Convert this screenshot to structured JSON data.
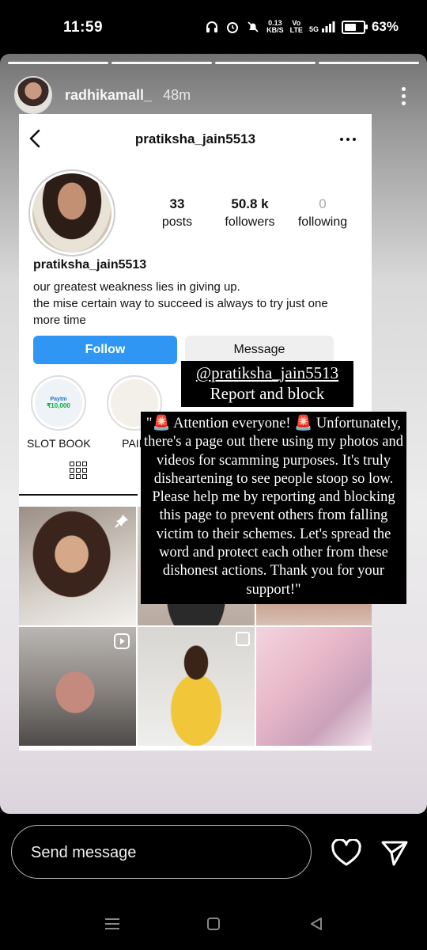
{
  "status_bar": {
    "time": "11:59",
    "net_speed_value": "0.13",
    "net_speed_unit": "KB/S",
    "volte_top": "Vo",
    "volte_bottom": "LTE",
    "network": "5G",
    "battery_percent": "63%",
    "battery_level": 0.63
  },
  "story": {
    "progress_segments": 4,
    "username": "radhikamall_",
    "time_ago": "48m"
  },
  "profile": {
    "header_username": "pratiksha_jain5513",
    "stats": [
      {
        "value": "33",
        "label": "posts"
      },
      {
        "value": "50.8 k",
        "label": "followers"
      },
      {
        "value": "0",
        "label": "following"
      }
    ],
    "display_name": "pratiksha_jain5513",
    "bio_line1": "our greatest weakness lies in giving up.",
    "bio_line2": "the mise certain way to succeed is always to try just one more time",
    "follow_label": "Follow",
    "message_label": "Message",
    "highlights": [
      {
        "label": "SLOT BOOK",
        "brand": "Paytm",
        "amount": "₹10,000"
      },
      {
        "label": "PAID",
        "brand": "",
        "amount": ""
      }
    ]
  },
  "overlay": {
    "tag_handle": "@pratiksha_jain5513",
    "tag_action": "Report and block",
    "message": "\"🚨 Attention everyone! 🚨 Unfortunately, there's a page out there using my photos and videos for scamming purposes. It's truly disheartening to see people stoop so low. Please help me by reporting and blocking this page to prevent others from falling victim to their schemes. Let's spread the word and protect each other from these dishonest actions. Thank you for your support!\""
  },
  "reply_bar": {
    "placeholder": "Send message"
  },
  "icons": {
    "back": "chevron-left-icon",
    "more": "more-horizontal-icon",
    "grid": "grid-icon",
    "pin": "pin-icon",
    "reel": "reel-icon",
    "heart": "heart-icon",
    "send": "paper-plane-icon"
  },
  "colors": {
    "follow_button": "#2f97f3",
    "overlay_bg": "#000000"
  }
}
